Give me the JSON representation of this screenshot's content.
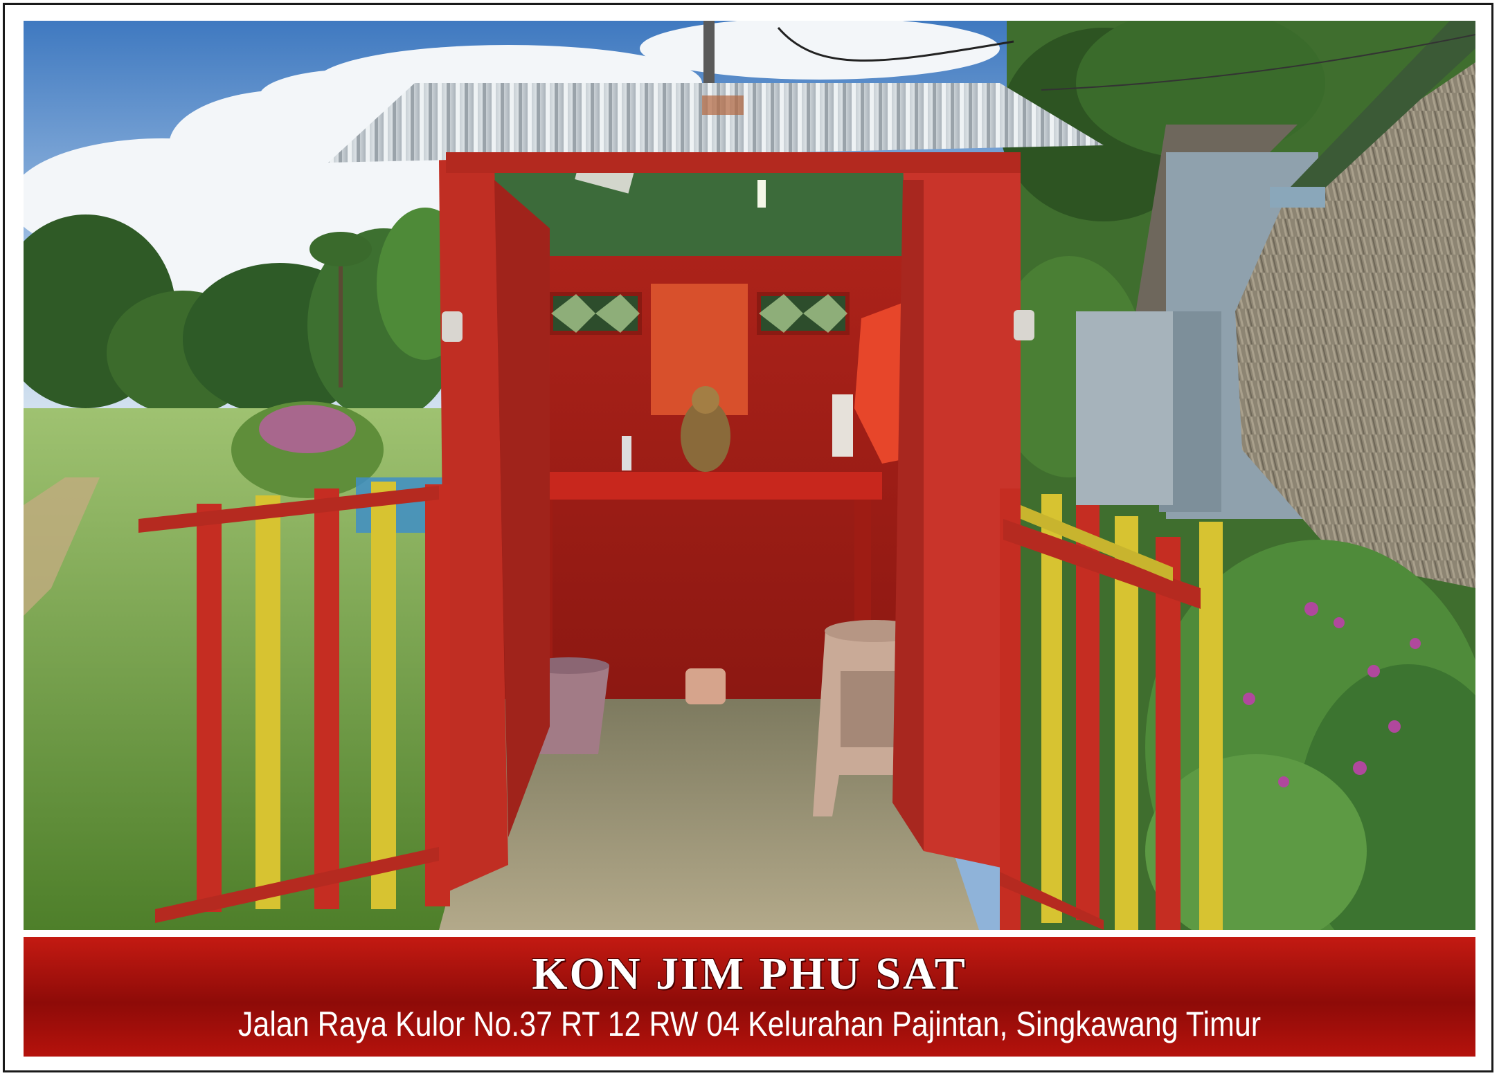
{
  "caption": {
    "title": "KON JIM PHU SAT",
    "address": "Jalan Raya Kulor No.37  RT 12 RW 04 Kelurahan Pajintan, Singkawang Timur"
  },
  "colors": {
    "band": "#a8120c",
    "shrine": "#c23127",
    "sky": "#8fb3d9",
    "grass": "#6f9d3e"
  },
  "photo": {
    "subject": "shrine-photo"
  }
}
